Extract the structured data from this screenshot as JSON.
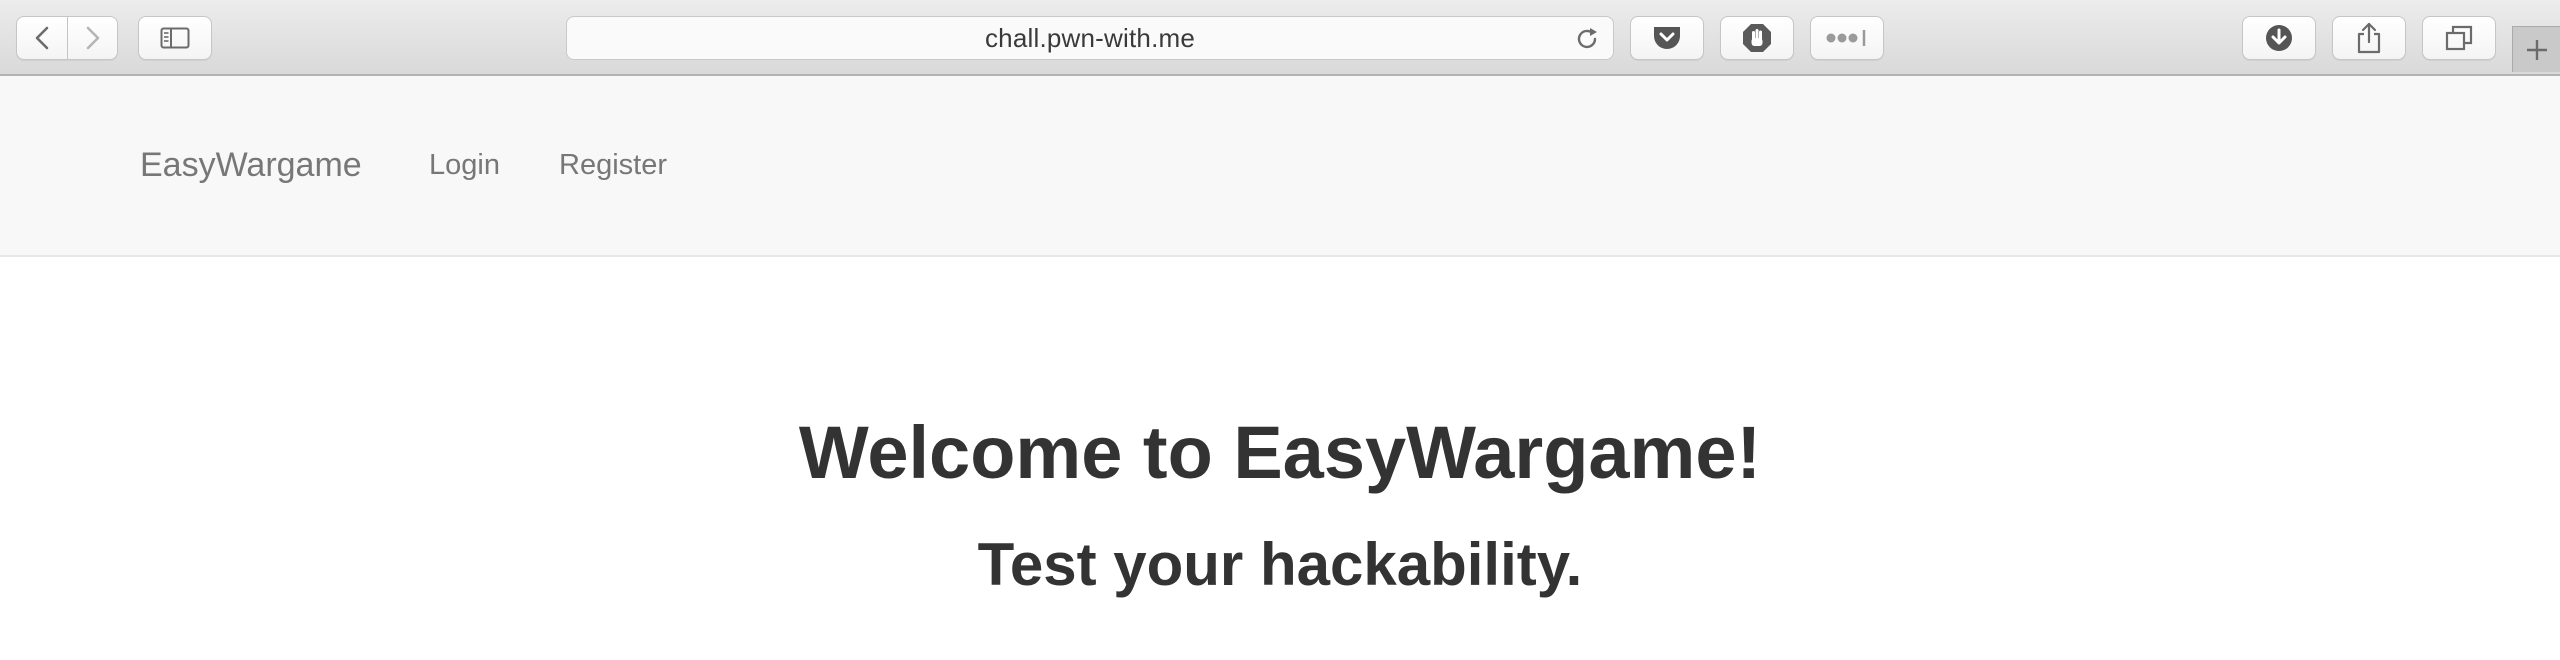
{
  "browser": {
    "url": "chall.pwn-with.me",
    "icons": {
      "back": "chevron-left-icon",
      "forward": "chevron-right-icon",
      "sidebar": "sidebar-icon",
      "reload": "reload-icon",
      "pocket": "pocket-icon",
      "adblock": "hand-stop-icon",
      "password": "password-dots-icon",
      "downloads": "download-icon",
      "share": "share-icon",
      "tabs": "tabs-overview-icon",
      "new_tab": "plus-icon"
    }
  },
  "navbar": {
    "brand": "EasyWargame",
    "links": [
      "Login",
      "Register"
    ]
  },
  "hero": {
    "title": "Welcome to EasyWargame!",
    "subtitle": "Test your hackability."
  },
  "colors": {
    "navbar_bg": "#f8f8f8",
    "nav_text": "#777777",
    "heading_text": "#333333"
  }
}
